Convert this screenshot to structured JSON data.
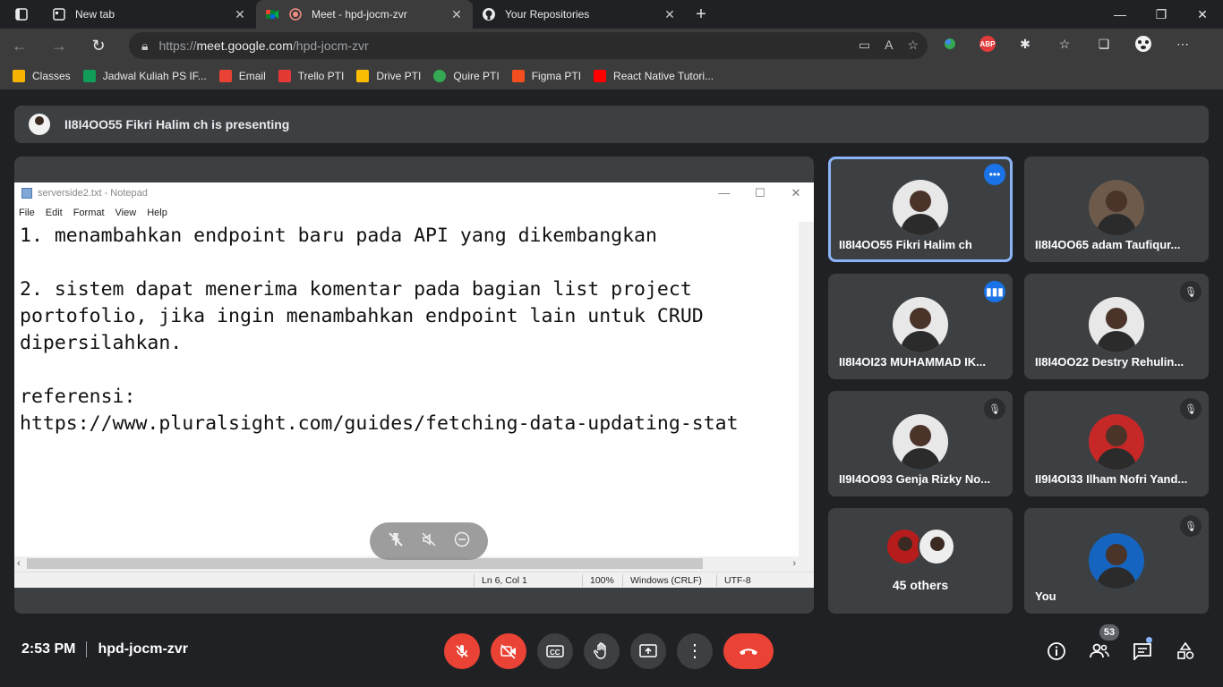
{
  "browser": {
    "tabs": [
      {
        "label": "New tab",
        "icon": "new-tab-icon"
      },
      {
        "label": "Meet - hpd-jocm-zvr",
        "icon": "google-meet-icon"
      },
      {
        "label": "Your Repositories",
        "icon": "github-icon"
      }
    ],
    "url_prefix": "https://",
    "url_host": "meet.google.com",
    "url_path": "/hpd-jocm-zvr",
    "bookmarks": [
      {
        "label": "Classes",
        "color": "#f6b400"
      },
      {
        "label": "Jadwal Kuliah PS IF...",
        "color": "#0f9d58"
      },
      {
        "label": "Email",
        "color": "#ea4335"
      },
      {
        "label": "Trello PTI",
        "color": "#e53935"
      },
      {
        "label": "Drive PTI",
        "color": "#fbbc04"
      },
      {
        "label": "Quire PTI",
        "color": "#34a853"
      },
      {
        "label": "Figma PTI",
        "color": "#f24e1e"
      },
      {
        "label": "React Native Tutori...",
        "color": "#ff0000"
      }
    ],
    "extension_abp": "ABP"
  },
  "meet": {
    "presenting_text": "II8I4OO55 Fikri Halim ch is presenting",
    "notepad": {
      "title": "serverside2.txt - Notepad",
      "menu": [
        "File",
        "Edit",
        "Format",
        "View",
        "Help"
      ],
      "content": "1. menambahkan endpoint baru pada API yang dikembangkan\n\n2. sistem dapat menerima komentar pada bagian list project\nportofolio, jika ingin menambahkan endpoint lain untuk CRUD\ndipersilahkan.\n\nreferensi:\nhttps://www.pluralsight.com/guides/fetching-data-updating-stat",
      "status_position": "Ln 6, Col 1",
      "status_zoom": "100%",
      "status_eol": "Windows (CRLF)",
      "status_encoding": "UTF-8"
    },
    "participants": [
      {
        "name": "II8I4OO55 Fikri Halim ch",
        "badge": "more"
      },
      {
        "name": "II8I4OO65 adam Taufiqur...",
        "badge": ""
      },
      {
        "name": "II8I4OI23 MUHAMMAD IK...",
        "badge": "speaking"
      },
      {
        "name": "II8I4OO22 Destry Rehulin...",
        "badge": "muted"
      },
      {
        "name": "II9I4OO93 Genja Rizky No...",
        "badge": "muted"
      },
      {
        "name": "II9I4OI33 Ilham Nofri Yand...",
        "badge": "muted"
      },
      {
        "name": "45 others",
        "badge": ""
      },
      {
        "name": "You",
        "badge": "muted"
      }
    ],
    "time": "2:53 PM",
    "meeting_code": "hpd-jocm-zvr",
    "participant_count": "53"
  }
}
